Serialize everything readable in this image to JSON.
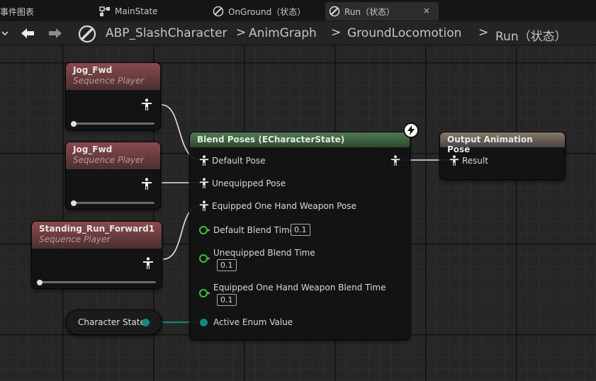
{
  "tabs": [
    {
      "label": "事件图表"
    },
    {
      "label": "MainState"
    },
    {
      "label": "OnGround（状态）"
    },
    {
      "label": "Run（状态）",
      "active": true,
      "close": "×"
    }
  ],
  "breadcrumb": {
    "items": [
      "ABP_SlashCharacter",
      "AnimGraph",
      "GroundLocomotion",
      "Run（状态）"
    ],
    "separator": ">"
  },
  "nodes": {
    "jog1": {
      "title": "Jog_Fwd",
      "subtitle": "Sequence Player"
    },
    "jog2": {
      "title": "Jog_Fwd",
      "subtitle": "Sequence Player"
    },
    "standing": {
      "title": "Standing_Run_Forward1",
      "subtitle": "Sequence Player"
    },
    "character_state": {
      "label": "Character State"
    },
    "blend": {
      "title": "Blend Poses (ECharacterState)",
      "pins": {
        "default_pose": "Default Pose",
        "unequipped_pose": "Unequipped Pose",
        "equipped_pose": "Equipped One Hand Weapon Pose",
        "default_blend": {
          "label": "Default Blend Time",
          "value": "0.1"
        },
        "unequipped_blend": {
          "label": "Unequipped Blend Time",
          "value": "0.1"
        },
        "equipped_blend": {
          "label": "Equipped One Hand Weapon Blend Time",
          "value": "0.1"
        },
        "active_enum": "Active Enum Value"
      }
    },
    "output": {
      "title": "Output Animation Pose",
      "result": "Result"
    }
  },
  "colors": {
    "sequence_header": "#8b4a4d",
    "blend_header": "#4f7a51",
    "output_header": "#86786c",
    "float_pin": "#3fbf3a",
    "enum_pin": "#0f8a7e",
    "wire_pose": "#e6e6e6",
    "wire_enum": "#0f8a7e"
  },
  "icons": {
    "pose": "pose-person-icon",
    "fast_path": "lightning-icon",
    "back": "back-arrow-icon",
    "forward": "forward-arrow-icon",
    "anim_blueprint": "anim-blueprint-icon"
  }
}
